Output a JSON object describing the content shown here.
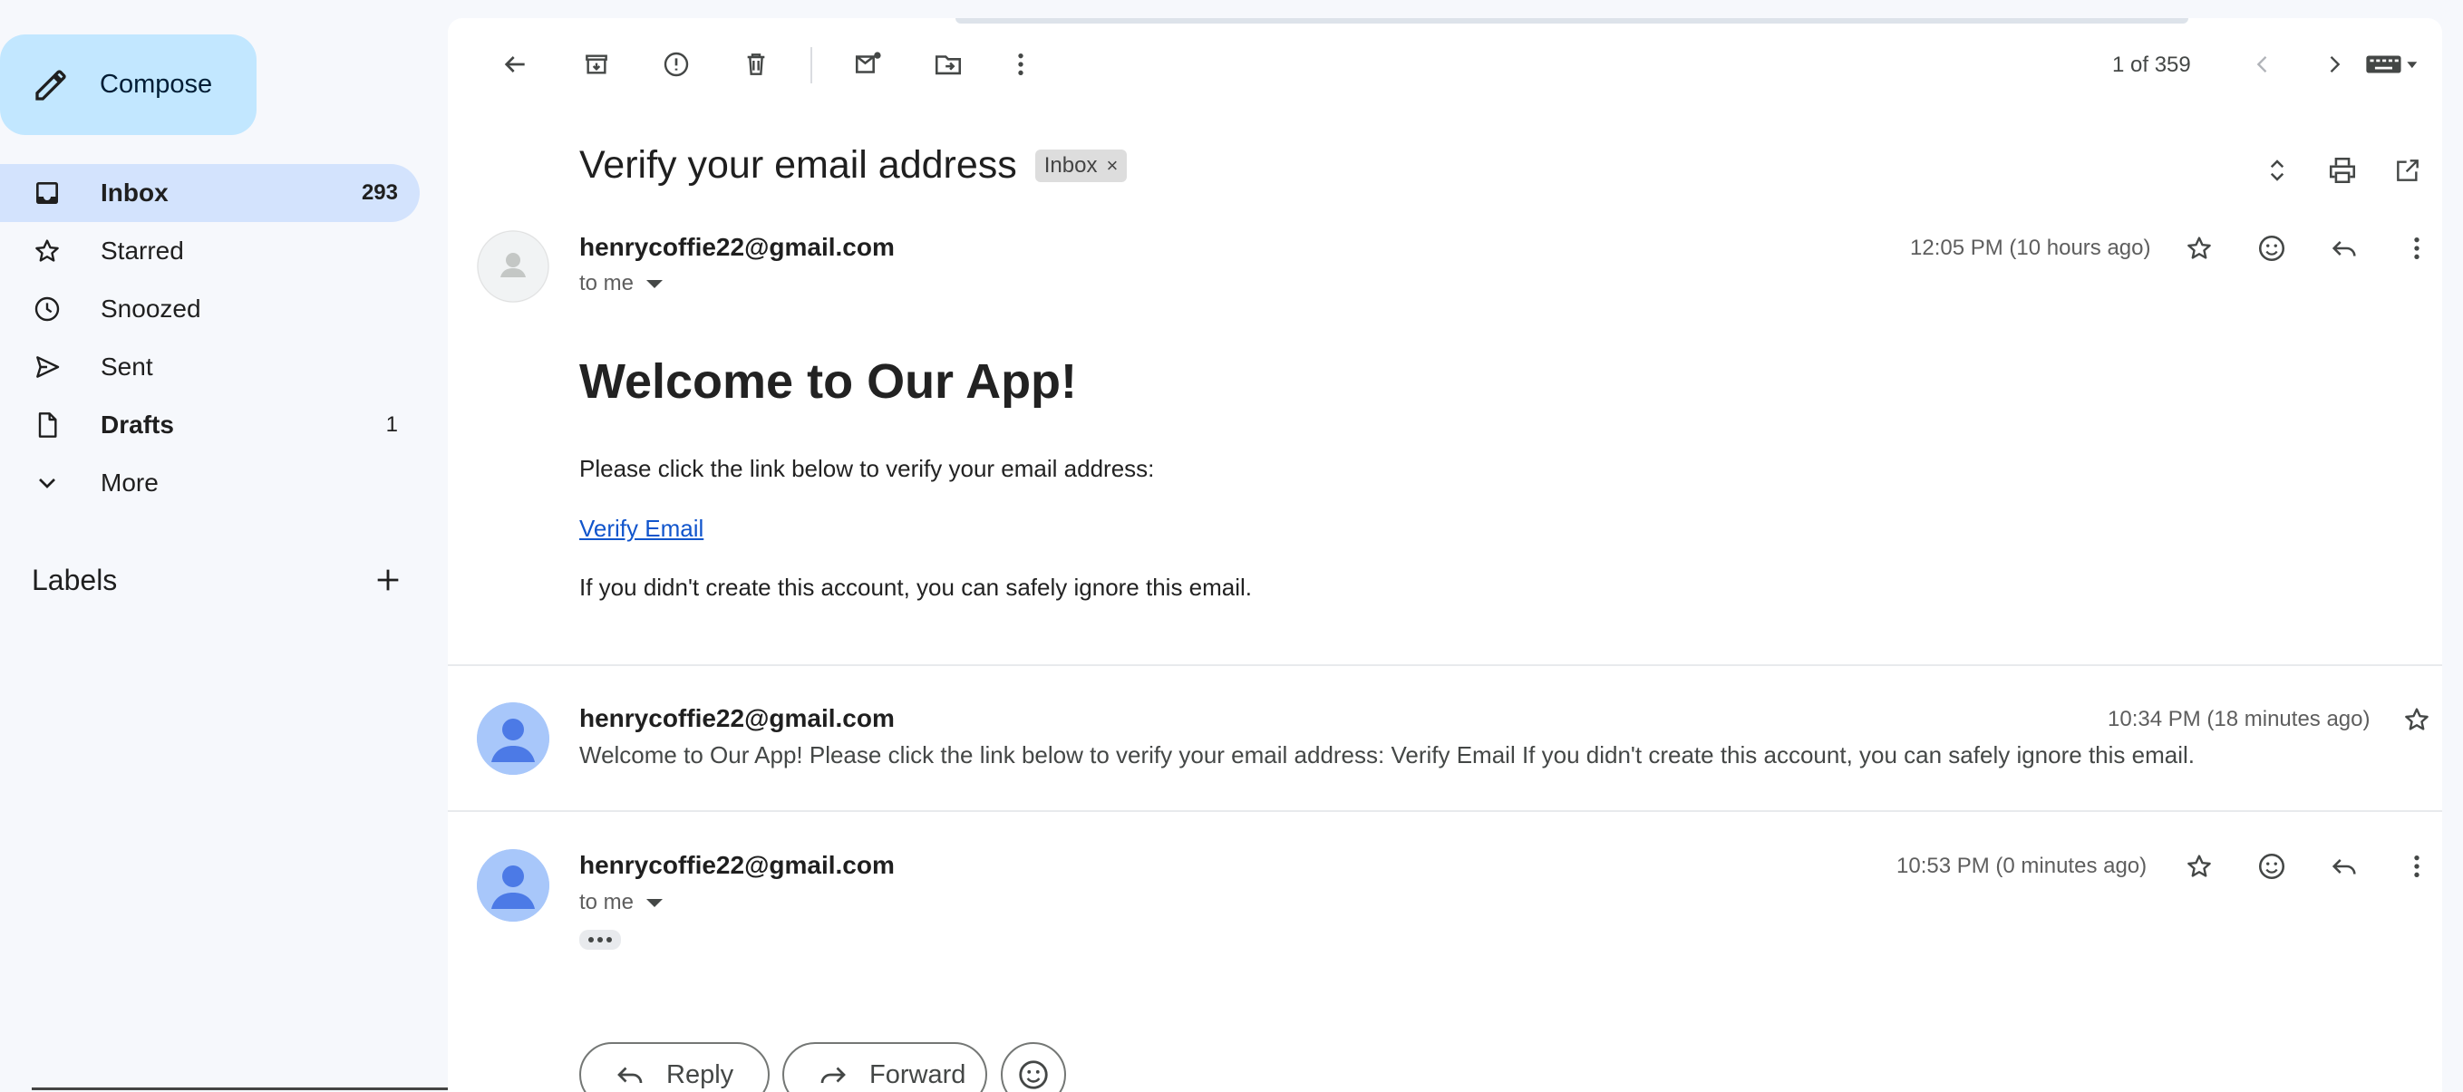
{
  "sidebar": {
    "compose_label": "Compose",
    "items": [
      {
        "label": "Inbox",
        "count": "293",
        "icon": "inbox-icon"
      },
      {
        "label": "Starred",
        "count": "",
        "icon": "star-icon"
      },
      {
        "label": "Snoozed",
        "count": "",
        "icon": "clock-icon"
      },
      {
        "label": "Sent",
        "count": "",
        "icon": "send-icon"
      },
      {
        "label": "Drafts",
        "count": "1",
        "icon": "draft-icon"
      },
      {
        "label": "More",
        "count": "",
        "icon": "chevron-down-icon"
      }
    ],
    "labels_title": "Labels"
  },
  "toolbar": {
    "pager": "1 of 359",
    "icons": [
      "back-arrow-icon",
      "archive-icon",
      "report-spam-icon",
      "delete-icon",
      "mark-unread-icon",
      "move-to-icon",
      "more-vert-icon",
      "prev-icon",
      "next-icon",
      "keyboard-icon"
    ]
  },
  "thread": {
    "subject": "Verify your email address",
    "label_chip": "Inbox",
    "label_chip_close": "×",
    "messages": [
      {
        "sender": "henrycoffie22@gmail.com",
        "to": "to me",
        "time": "12:05 PM (10 hours ago)",
        "heading": "Welcome to Our App!",
        "line1": "Please click the link below to verify your email address:",
        "link": "Verify Email",
        "line2": "If you didn't create this account, you can safely ignore this email."
      },
      {
        "sender": "henrycoffie22@gmail.com",
        "time": "10:34 PM (18 minutes ago)",
        "snippet": "Welcome to Our App! Please click the link below to verify your email address: Verify Email If you didn't create this account, you can safely ignore this email."
      },
      {
        "sender": "henrycoffie22@gmail.com",
        "to": "to me",
        "time": "10:53 PM (0 minutes ago)"
      }
    ]
  },
  "actions": {
    "reply": "Reply",
    "forward": "Forward"
  },
  "colors": {
    "accent": "#c2e7ff",
    "active_nav": "#d3e3fd",
    "link": "#1155cc",
    "avatar_blue": "#a8c7fa",
    "avatar_dark": "#4c7ae6"
  }
}
